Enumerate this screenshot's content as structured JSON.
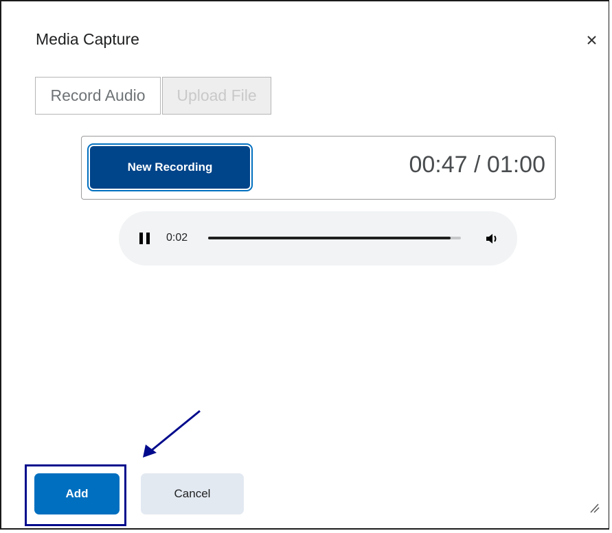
{
  "dialog": {
    "title": "Media Capture"
  },
  "tabs": [
    {
      "label": "Record Audio",
      "state": "active"
    },
    {
      "label": "Upload File",
      "state": "disabled"
    }
  ],
  "recorder": {
    "new_recording_label": "New Recording",
    "timer": "00:47 / 01:00"
  },
  "player": {
    "state": "playing",
    "current_time": "0:02",
    "progress_fraction": 0.96
  },
  "footer": {
    "add_label": "Add",
    "cancel_label": "Cancel"
  },
  "icons": {
    "close": "close-icon",
    "pause": "pause-icon",
    "volume": "volume-icon",
    "resize": "resize-handle-icon"
  },
  "colors": {
    "primary": "#006fbf",
    "primary_dark": "#004489",
    "annotation": "#000a8c",
    "secondary_button": "#e3e9f1"
  }
}
